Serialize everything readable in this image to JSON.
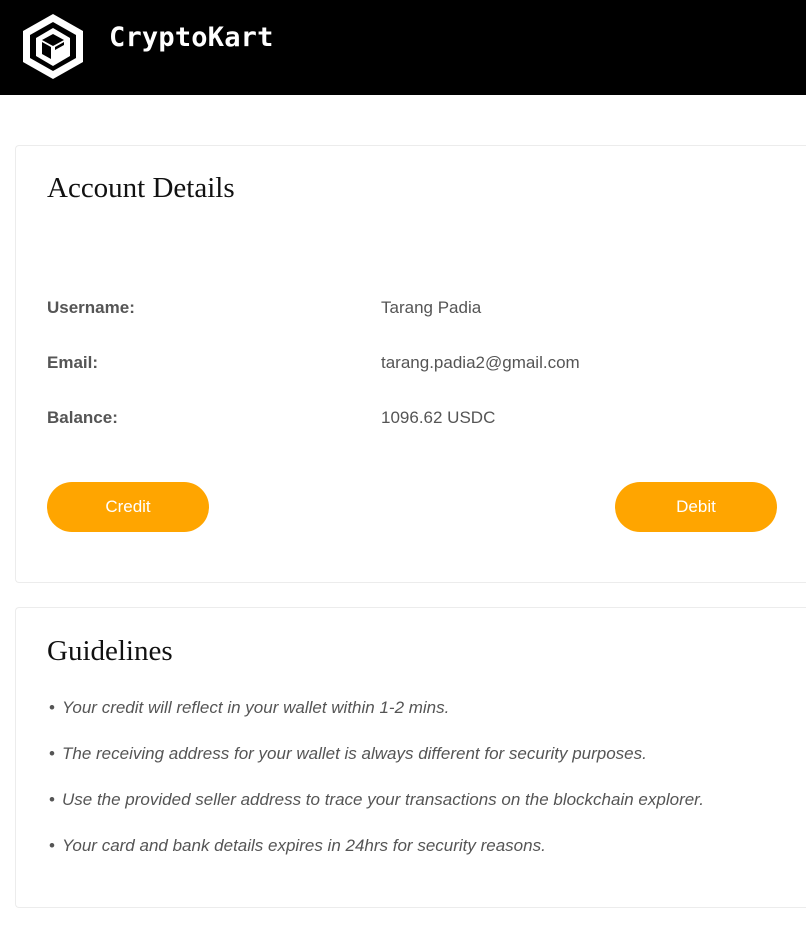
{
  "header": {
    "brand": "CryptoKart",
    "logo_icon": "hexagon-cube-logo-icon",
    "background": "#000000"
  },
  "account": {
    "title": "Account Details",
    "rows": [
      {
        "label": "Username:",
        "value": "Tarang Padia"
      },
      {
        "label": "Email:",
        "value": "tarang.padia2@gmail.com"
      },
      {
        "label": "Balance:",
        "value": "1096.62 USDC"
      }
    ],
    "credit_label": "Credit",
    "debit_label": "Debit",
    "button_color": "#ffa500"
  },
  "guidelines": {
    "title": "Guidelines",
    "bullet": "•",
    "items": [
      "Your credit will reflect in your wallet within 1-2 mins.",
      "The receiving address for your wallet is always different for security purposes.",
      "Use the provided seller address to trace your transactions on the blockchain explorer.",
      "Your card and bank details expires in 24hrs for security reasons."
    ]
  }
}
